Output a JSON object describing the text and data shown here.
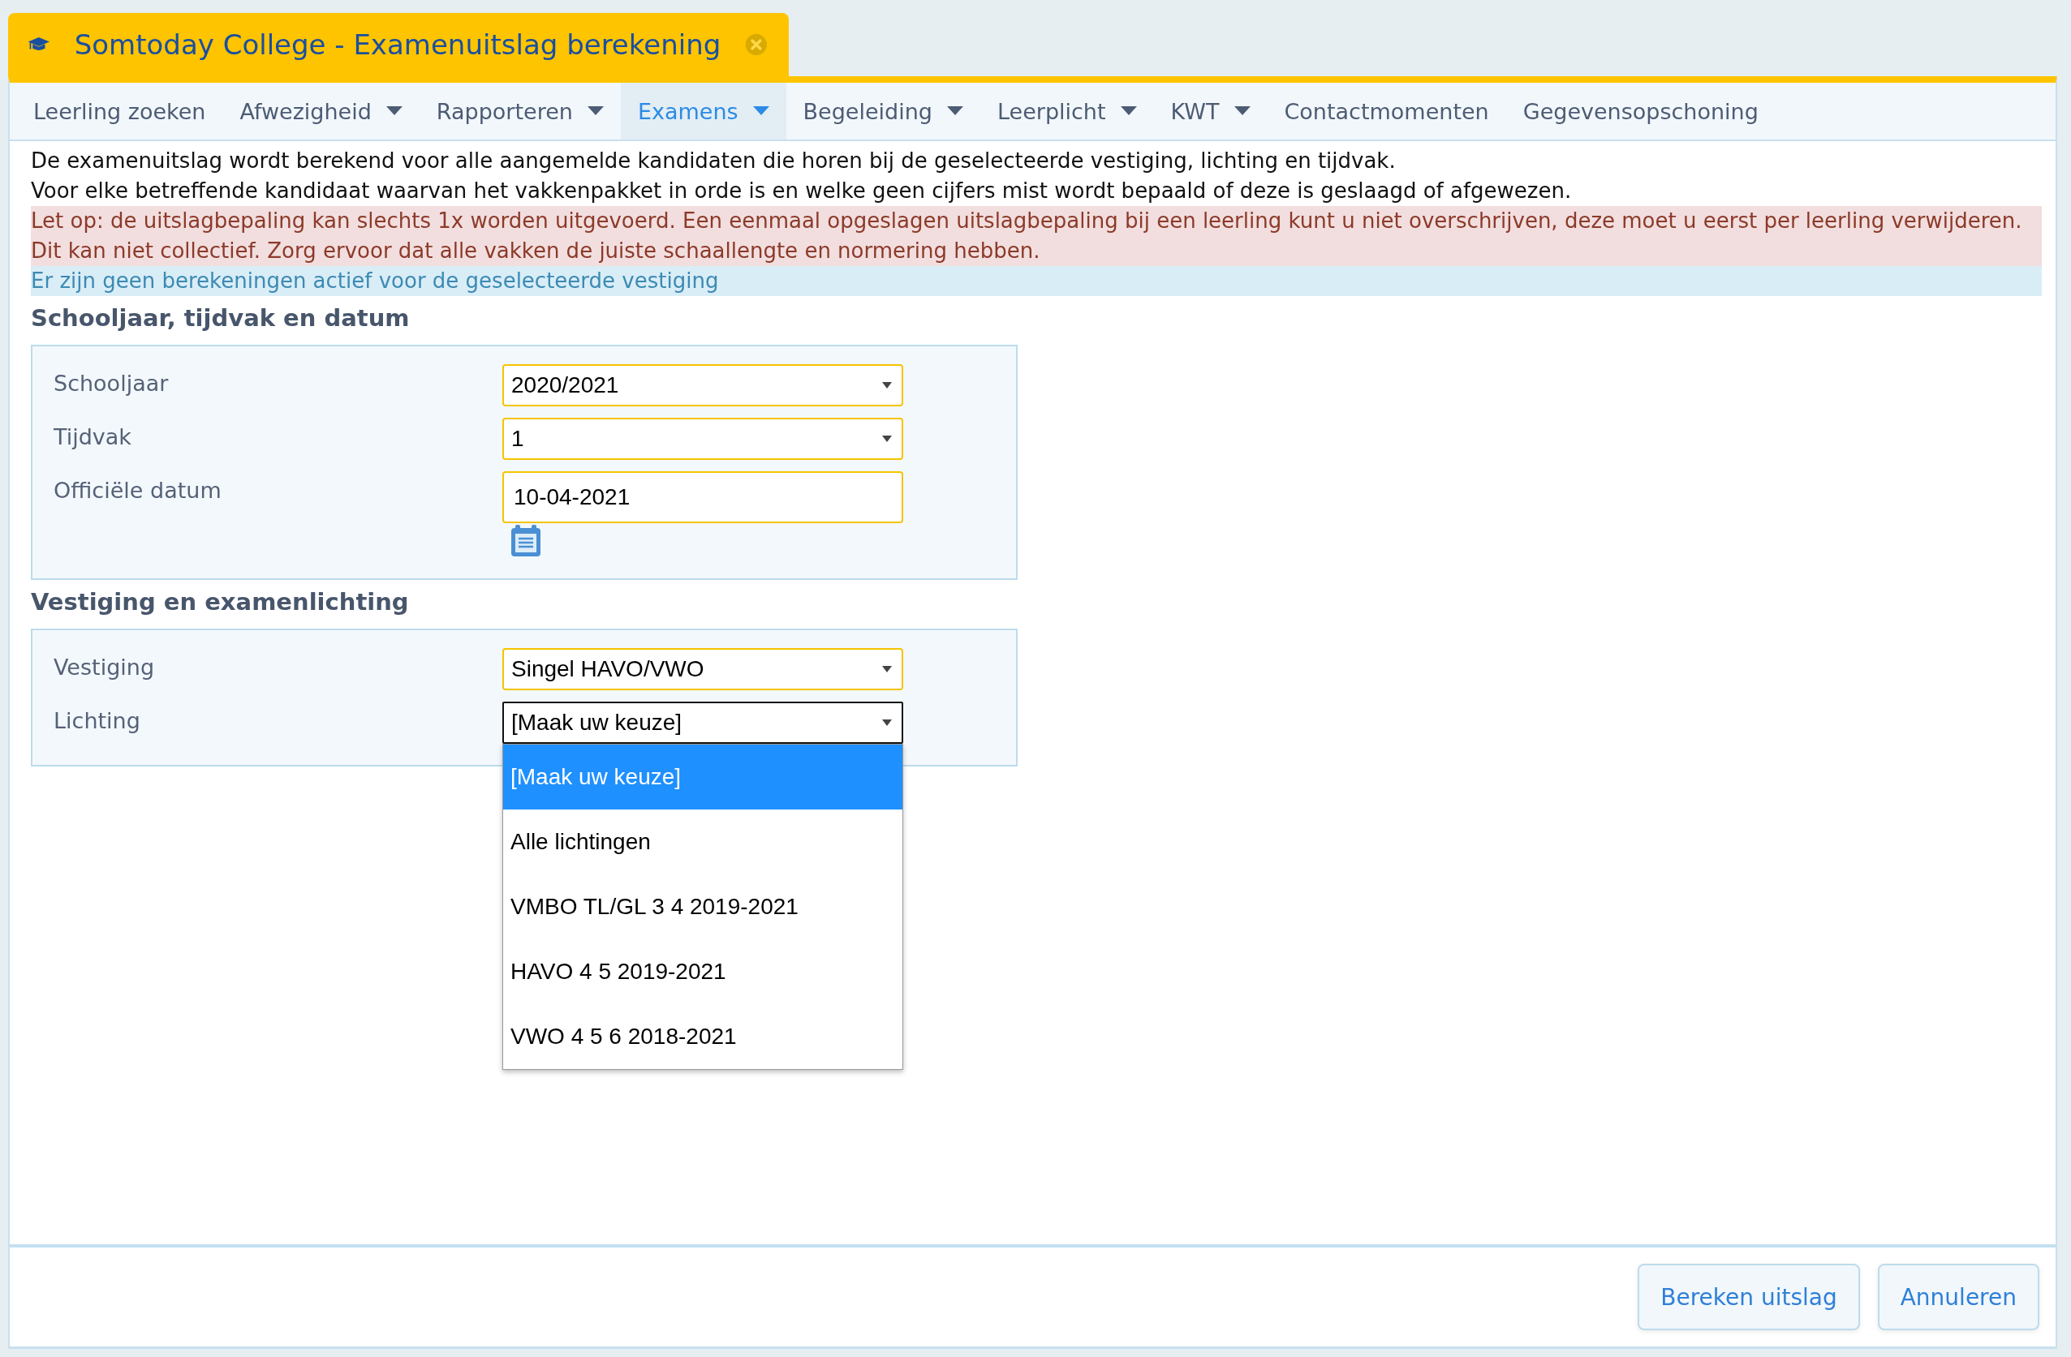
{
  "window_tab": {
    "title": "Somtoday College - Examenuitslag berekening"
  },
  "menu": [
    {
      "label": "Leerling zoeken",
      "has_dropdown": false,
      "selected": false
    },
    {
      "label": "Afwezigheid",
      "has_dropdown": true,
      "selected": false
    },
    {
      "label": "Rapporteren",
      "has_dropdown": true,
      "selected": false
    },
    {
      "label": "Examens",
      "has_dropdown": true,
      "selected": true
    },
    {
      "label": "Begeleiding",
      "has_dropdown": true,
      "selected": false
    },
    {
      "label": "Leerplicht",
      "has_dropdown": true,
      "selected": false
    },
    {
      "label": "KWT",
      "has_dropdown": true,
      "selected": false
    },
    {
      "label": "Contactmomenten",
      "has_dropdown": false,
      "selected": false
    },
    {
      "label": "Gegevensopschoning",
      "has_dropdown": false,
      "selected": false
    }
  ],
  "messages": [
    {
      "kind": "plain",
      "text": "De examenuitslag wordt berekend voor alle aangemelde kandidaten die horen bij de geselecteerde vestiging, lichting en tijdvak."
    },
    {
      "kind": "plain",
      "text": "Voor elke betreffende kandidaat waarvan het vakkenpakket in orde is en welke geen cijfers mist wordt bepaald of deze is geslaagd of afgewezen."
    },
    {
      "kind": "warning",
      "text": "Let op: de uitslagbepaling kan slechts 1x worden uitgevoerd. Een eenmaal opgeslagen uitslagbepaling bij een leerling kunt u niet overschrijven, deze moet u eerst per leerling verwijderen. Dit kan niet collectief. Zorg ervoor dat alle vakken de juiste schaallengte en normering hebben."
    },
    {
      "kind": "info",
      "text": "Er zijn geen berekeningen actief voor de geselecteerde vestiging"
    }
  ],
  "sections": [
    {
      "heading": "Schooljaar, tijdvak en datum",
      "fields": [
        {
          "label": "Schooljaar",
          "kind": "select",
          "value": "2020/2021",
          "focused": false
        },
        {
          "label": "Tijdvak",
          "kind": "select",
          "value": "1",
          "focused": false
        },
        {
          "label": "Officiële datum",
          "kind": "date",
          "value": "10-04-2021"
        }
      ]
    },
    {
      "heading": "Vestiging en examenlichting",
      "fields": [
        {
          "label": "Vestiging",
          "kind": "select",
          "value": "Singel HAVO/VWO",
          "focused": false
        },
        {
          "label": "Lichting",
          "kind": "select",
          "value": "[Maak uw keuze]",
          "focused": true,
          "options": [
            {
              "label": "[Maak uw keuze]",
              "selected": true
            },
            {
              "label": "Alle lichtingen",
              "selected": false
            },
            {
              "label": "VMBO TL/GL 3 4 2019-2021",
              "selected": false
            },
            {
              "label": "HAVO 4 5 2019-2021",
              "selected": false
            },
            {
              "label": "VWO 4 5 6 2018-2021",
              "selected": false
            }
          ]
        }
      ]
    }
  ],
  "buttons": [
    {
      "label": "Bereken uitslag"
    },
    {
      "label": "Annuleren"
    }
  ]
}
